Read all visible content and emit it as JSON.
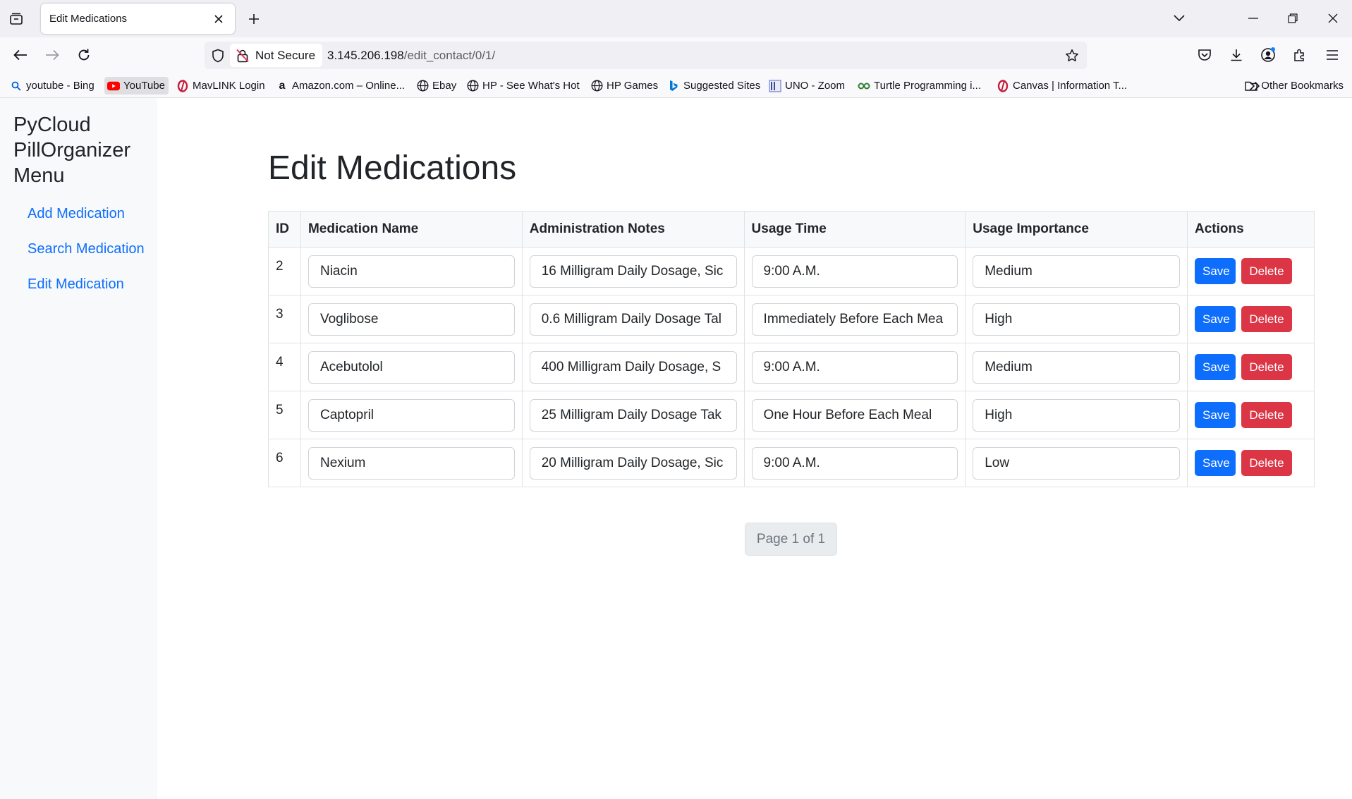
{
  "browser": {
    "tab_title": "Edit Medications",
    "security_label": "Not Secure",
    "url_host": "3.145.206.198",
    "url_path": "/edit_contact/0/1/",
    "bookmarks": [
      {
        "label": "youtube - Bing",
        "icon": "search-icon"
      },
      {
        "label": "YouTube",
        "icon": "youtube-icon"
      },
      {
        "label": "MavLINK Login",
        "icon": "mavlink-icon"
      },
      {
        "label": "Amazon.com – Online...",
        "icon": "amazon-icon"
      },
      {
        "label": "Ebay",
        "icon": "globe-icon"
      },
      {
        "label": "HP - See What's Hot",
        "icon": "globe-icon"
      },
      {
        "label": "HP Games",
        "icon": "globe-icon"
      },
      {
        "label": "Suggested Sites",
        "icon": "bing-icon"
      },
      {
        "label": "UNO - Zoom",
        "icon": "zoom-icon"
      },
      {
        "label": "Turtle Programming i...",
        "icon": "turtle-icon"
      },
      {
        "label": "Canvas | Information T...",
        "icon": "canvas-icon"
      }
    ],
    "other_bookmarks": "Other Bookmarks"
  },
  "sidebar": {
    "brand": "PyCloud PillOrganizer Menu",
    "links": [
      "Add Medication",
      "Search Medication",
      "Edit Medication"
    ]
  },
  "main": {
    "title": "Edit Medications",
    "columns": [
      "ID",
      "Medication Name",
      "Administration Notes",
      "Usage Time",
      "Usage Importance",
      "Actions"
    ],
    "rows": [
      {
        "id": "2",
        "name": "Niacin",
        "notes": "16 Milligram Daily Dosage, Sic",
        "time": "9:00 A.M.",
        "importance": "Medium"
      },
      {
        "id": "3",
        "name": "Voglibose",
        "notes": "0.6 Milligram Daily Dosage Tal",
        "time": "Immediately Before Each Mea",
        "importance": "High"
      },
      {
        "id": "4",
        "name": "Acebutolol",
        "notes": "400 Milligram Daily Dosage, S",
        "time": "9:00 A.M.",
        "importance": "Medium"
      },
      {
        "id": "5",
        "name": "Captopril",
        "notes": "25 Milligram Daily Dosage Tak",
        "time": "One Hour Before Each Meal",
        "importance": "High"
      },
      {
        "id": "6",
        "name": "Nexium",
        "notes": "20 Milligram Daily Dosage, Sic",
        "time": "9:00 A.M.",
        "importance": "Low"
      }
    ],
    "save_label": "Save",
    "delete_label": "Delete",
    "pagination": "Page 1 of 1"
  },
  "colors": {
    "link": "#0d6efd",
    "save": "#0d6efd",
    "delete": "#dc3545"
  }
}
